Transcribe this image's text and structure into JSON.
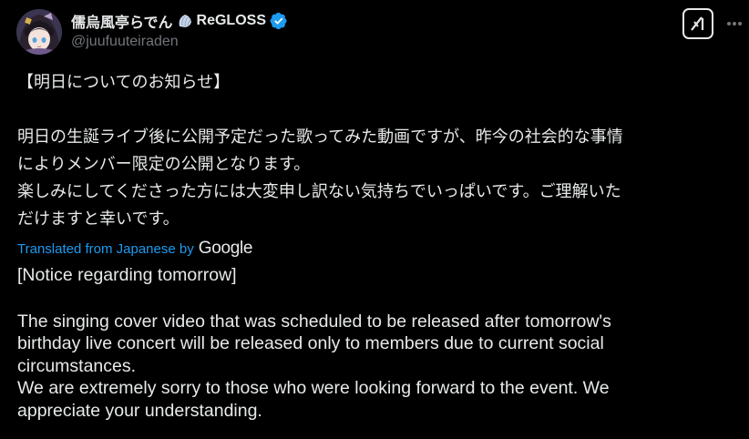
{
  "author": {
    "display_name": "儒烏風亭らでん",
    "shell_emoji": "shell-icon",
    "group": "ReGLOSS",
    "handle": "@juufuuteiraden",
    "verified": true
  },
  "actions": {
    "grok_icon": "grok-icon",
    "more_icon": "more-horizontal-icon"
  },
  "post": {
    "original_lines": [
      "【明日についてのお知らせ】",
      "",
      "明日の生誕ライブ後に公開予定だった歌ってみた動画ですが、昨今の社会的な事情",
      "によりメンバー限定の公開となります。",
      "楽しみにしてくださった方には大変申し訳ない気持ちでいっぱいです。ご理解いた",
      "だけますと幸いです。"
    ],
    "translation_label": "Translated from Japanese by",
    "translation_provider": "Google",
    "translated_lines": [
      "[Notice regarding tomorrow]",
      "",
      "The singing cover video that was scheduled to be released after tomorrow's",
      "birthday live concert will be released only to members due to current social",
      "circumstances.",
      "We are extremely sorry to those who were looking forward to the event. We",
      "appreciate your understanding."
    ]
  },
  "colors": {
    "background": "#000000",
    "text": "#e7e9ea",
    "secondary": "#71767b",
    "link": "#1d9bf0",
    "verified": "#1d9bf0"
  }
}
